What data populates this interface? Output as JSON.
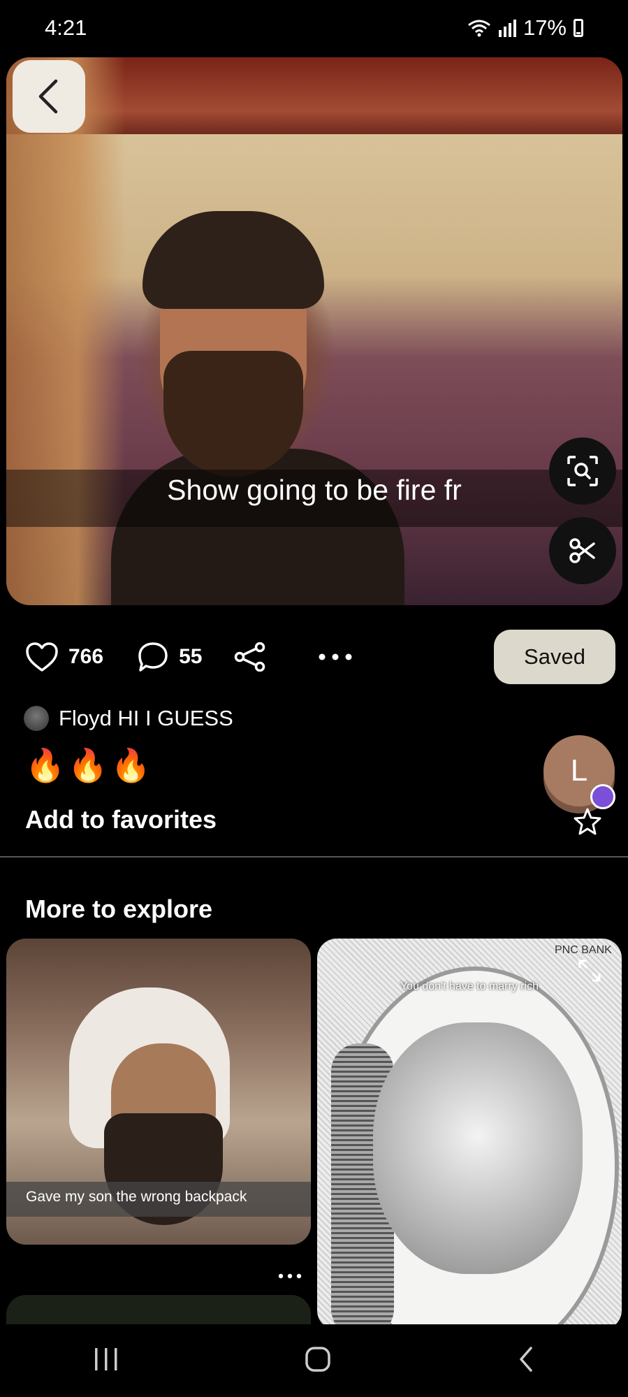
{
  "status_bar": {
    "time": "4:21",
    "battery": "17%"
  },
  "pin": {
    "caption": "Show going to be fire fr",
    "likes": "766",
    "comments": "55",
    "saved_label": "Saved",
    "author": "Floyd HI I GUESS",
    "description": "🔥🔥🔥",
    "favorites_label": "Add to favorites",
    "profile_initial": "L"
  },
  "explore": {
    "title": "More to explore",
    "cards": [
      {
        "caption": "Gave my son the wrong backpack"
      },
      {
        "caption": "You don't have to marry rich",
        "brand": "PNC BANK"
      }
    ]
  },
  "icons": [
    "back-icon",
    "lens-search-icon",
    "scissors-icon",
    "heart-icon",
    "comment-icon",
    "share-icon",
    "more-icon",
    "star-icon",
    "expand-icon",
    "nav-recents-icon",
    "nav-home-icon",
    "nav-back-icon"
  ]
}
